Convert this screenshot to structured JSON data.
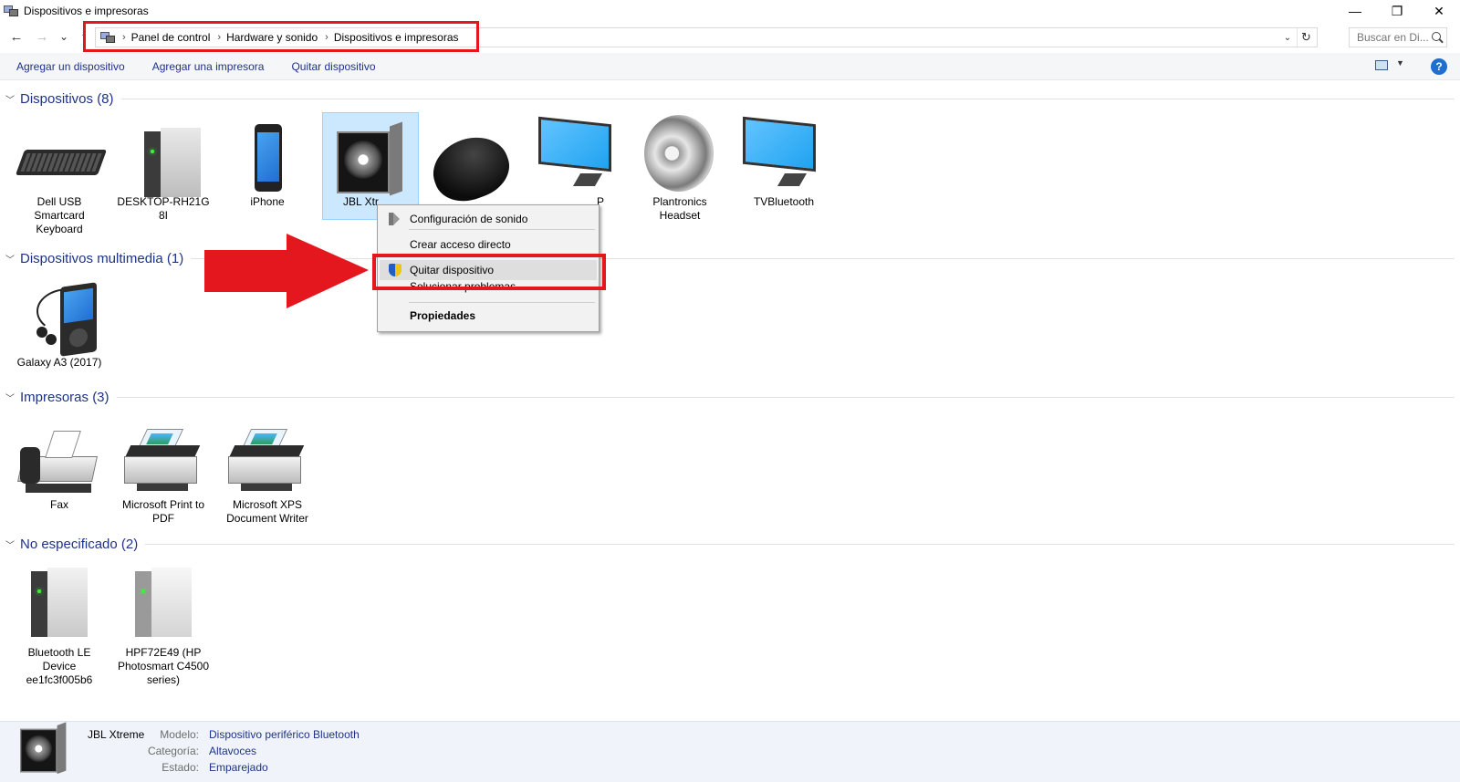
{
  "window": {
    "title": "Dispositivos e impresoras",
    "minimize": "—",
    "restore": "❐",
    "close": "✕"
  },
  "nav": {
    "back": "←",
    "forward": "→",
    "recent": "⌄",
    "up": "↑"
  },
  "breadcrumb": {
    "items": [
      "Panel de control",
      "Hardware y sonido",
      "Dispositivos e impresoras"
    ],
    "separator": "›"
  },
  "search": {
    "placeholder": "Buscar en Di..."
  },
  "toolbar": {
    "add_device": "Agregar un dispositivo",
    "add_printer": "Agregar una impresora",
    "remove_device": "Quitar dispositivo",
    "help": "?"
  },
  "groups": {
    "devices": {
      "title": "Dispositivos (8)",
      "items": [
        {
          "label": "Dell USB Smartcard Keyboard",
          "icon": "keyboard-icon"
        },
        {
          "label": "DESKTOP-RH21G 8I",
          "icon": "computer-tower-icon"
        },
        {
          "label": "iPhone",
          "icon": "phone-icon"
        },
        {
          "label": "JBL Xtr",
          "icon": "speaker-icon"
        },
        {
          "label": "",
          "icon": "mouse-icon"
        },
        {
          "label": "P",
          "icon": "monitor-icon"
        },
        {
          "label": "Plantronics Headset",
          "icon": "horn-speaker-icon"
        },
        {
          "label": "TVBluetooth",
          "icon": "monitor-icon"
        }
      ]
    },
    "multimedia": {
      "title": "Dispositivos multimedia (1)",
      "items": [
        {
          "label": "Galaxy A3 (2017)",
          "icon": "media-player-icon"
        }
      ]
    },
    "printers": {
      "title": "Impresoras (3)",
      "items": [
        {
          "label": "Fax",
          "icon": "fax-icon"
        },
        {
          "label": "Microsoft Print to PDF",
          "icon": "printer-icon"
        },
        {
          "label": "Microsoft XPS Document Writer",
          "icon": "printer-icon"
        }
      ]
    },
    "unspecified": {
      "title": "No especificado (2)",
      "items": [
        {
          "label": "Bluetooth LE Device ee1fc3f005b6",
          "icon": "device-box-icon"
        },
        {
          "label": "HPF72E49 (HP Photosmart C4500 series)",
          "icon": "device-box-icon"
        }
      ]
    }
  },
  "context_menu": {
    "items": [
      {
        "label": "Configuración de sonido",
        "icon": "speaker-small-icon"
      },
      {
        "label": "Crear acceso directo"
      },
      {
        "label": "Quitar dispositivo",
        "icon": "uac-shield-icon",
        "highlighted": true
      },
      {
        "label": "Solucionar problemas"
      },
      {
        "label": "Propiedades",
        "bold": true
      }
    ]
  },
  "details": {
    "name": "JBL Xtreme",
    "model_key": "Modelo:",
    "model_val": "Dispositivo periférico Bluetooth",
    "category_key": "Categoría:",
    "category_val": "Altavoces",
    "state_key": "Estado:",
    "state_val": "Emparejado"
  },
  "colors": {
    "accent_text": "#1e3287",
    "annotation_red": "#e4161e",
    "selection_bg": "#cce8ff"
  }
}
